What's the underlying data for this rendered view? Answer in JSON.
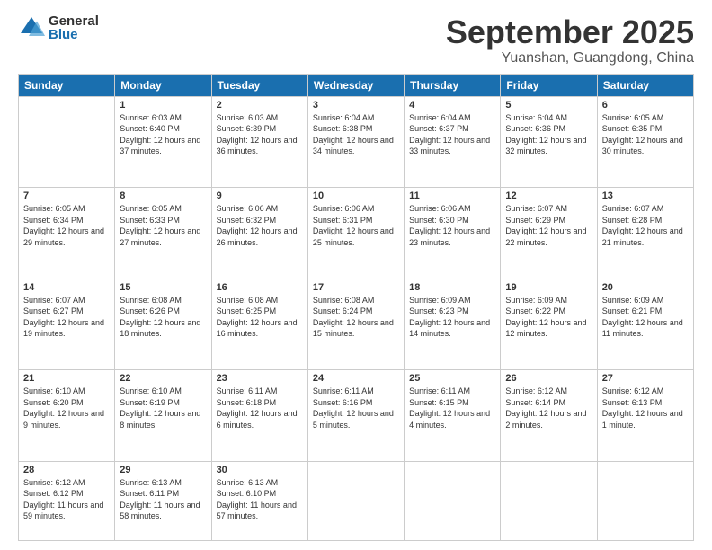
{
  "logo": {
    "general": "General",
    "blue": "Blue"
  },
  "title": {
    "month_year": "September 2025",
    "location": "Yuanshan, Guangdong, China"
  },
  "headers": [
    "Sunday",
    "Monday",
    "Tuesday",
    "Wednesday",
    "Thursday",
    "Friday",
    "Saturday"
  ],
  "weeks": [
    [
      {
        "day": "",
        "info": ""
      },
      {
        "day": "1",
        "info": "Sunrise: 6:03 AM\nSunset: 6:40 PM\nDaylight: 12 hours\nand 37 minutes."
      },
      {
        "day": "2",
        "info": "Sunrise: 6:03 AM\nSunset: 6:39 PM\nDaylight: 12 hours\nand 36 minutes."
      },
      {
        "day": "3",
        "info": "Sunrise: 6:04 AM\nSunset: 6:38 PM\nDaylight: 12 hours\nand 34 minutes."
      },
      {
        "day": "4",
        "info": "Sunrise: 6:04 AM\nSunset: 6:37 PM\nDaylight: 12 hours\nand 33 minutes."
      },
      {
        "day": "5",
        "info": "Sunrise: 6:04 AM\nSunset: 6:36 PM\nDaylight: 12 hours\nand 32 minutes."
      },
      {
        "day": "6",
        "info": "Sunrise: 6:05 AM\nSunset: 6:35 PM\nDaylight: 12 hours\nand 30 minutes."
      }
    ],
    [
      {
        "day": "7",
        "info": "Sunrise: 6:05 AM\nSunset: 6:34 PM\nDaylight: 12 hours\nand 29 minutes."
      },
      {
        "day": "8",
        "info": "Sunrise: 6:05 AM\nSunset: 6:33 PM\nDaylight: 12 hours\nand 27 minutes."
      },
      {
        "day": "9",
        "info": "Sunrise: 6:06 AM\nSunset: 6:32 PM\nDaylight: 12 hours\nand 26 minutes."
      },
      {
        "day": "10",
        "info": "Sunrise: 6:06 AM\nSunset: 6:31 PM\nDaylight: 12 hours\nand 25 minutes."
      },
      {
        "day": "11",
        "info": "Sunrise: 6:06 AM\nSunset: 6:30 PM\nDaylight: 12 hours\nand 23 minutes."
      },
      {
        "day": "12",
        "info": "Sunrise: 6:07 AM\nSunset: 6:29 PM\nDaylight: 12 hours\nand 22 minutes."
      },
      {
        "day": "13",
        "info": "Sunrise: 6:07 AM\nSunset: 6:28 PM\nDaylight: 12 hours\nand 21 minutes."
      }
    ],
    [
      {
        "day": "14",
        "info": "Sunrise: 6:07 AM\nSunset: 6:27 PM\nDaylight: 12 hours\nand 19 minutes."
      },
      {
        "day": "15",
        "info": "Sunrise: 6:08 AM\nSunset: 6:26 PM\nDaylight: 12 hours\nand 18 minutes."
      },
      {
        "day": "16",
        "info": "Sunrise: 6:08 AM\nSunset: 6:25 PM\nDaylight: 12 hours\nand 16 minutes."
      },
      {
        "day": "17",
        "info": "Sunrise: 6:08 AM\nSunset: 6:24 PM\nDaylight: 12 hours\nand 15 minutes."
      },
      {
        "day": "18",
        "info": "Sunrise: 6:09 AM\nSunset: 6:23 PM\nDaylight: 12 hours\nand 14 minutes."
      },
      {
        "day": "19",
        "info": "Sunrise: 6:09 AM\nSunset: 6:22 PM\nDaylight: 12 hours\nand 12 minutes."
      },
      {
        "day": "20",
        "info": "Sunrise: 6:09 AM\nSunset: 6:21 PM\nDaylight: 12 hours\nand 11 minutes."
      }
    ],
    [
      {
        "day": "21",
        "info": "Sunrise: 6:10 AM\nSunset: 6:20 PM\nDaylight: 12 hours\nand 9 minutes."
      },
      {
        "day": "22",
        "info": "Sunrise: 6:10 AM\nSunset: 6:19 PM\nDaylight: 12 hours\nand 8 minutes."
      },
      {
        "day": "23",
        "info": "Sunrise: 6:11 AM\nSunset: 6:18 PM\nDaylight: 12 hours\nand 6 minutes."
      },
      {
        "day": "24",
        "info": "Sunrise: 6:11 AM\nSunset: 6:16 PM\nDaylight: 12 hours\nand 5 minutes."
      },
      {
        "day": "25",
        "info": "Sunrise: 6:11 AM\nSunset: 6:15 PM\nDaylight: 12 hours\nand 4 minutes."
      },
      {
        "day": "26",
        "info": "Sunrise: 6:12 AM\nSunset: 6:14 PM\nDaylight: 12 hours\nand 2 minutes."
      },
      {
        "day": "27",
        "info": "Sunrise: 6:12 AM\nSunset: 6:13 PM\nDaylight: 12 hours\nand 1 minute."
      }
    ],
    [
      {
        "day": "28",
        "info": "Sunrise: 6:12 AM\nSunset: 6:12 PM\nDaylight: 11 hours\nand 59 minutes."
      },
      {
        "day": "29",
        "info": "Sunrise: 6:13 AM\nSunset: 6:11 PM\nDaylight: 11 hours\nand 58 minutes."
      },
      {
        "day": "30",
        "info": "Sunrise: 6:13 AM\nSunset: 6:10 PM\nDaylight: 11 hours\nand 57 minutes."
      },
      {
        "day": "",
        "info": ""
      },
      {
        "day": "",
        "info": ""
      },
      {
        "day": "",
        "info": ""
      },
      {
        "day": "",
        "info": ""
      }
    ]
  ]
}
